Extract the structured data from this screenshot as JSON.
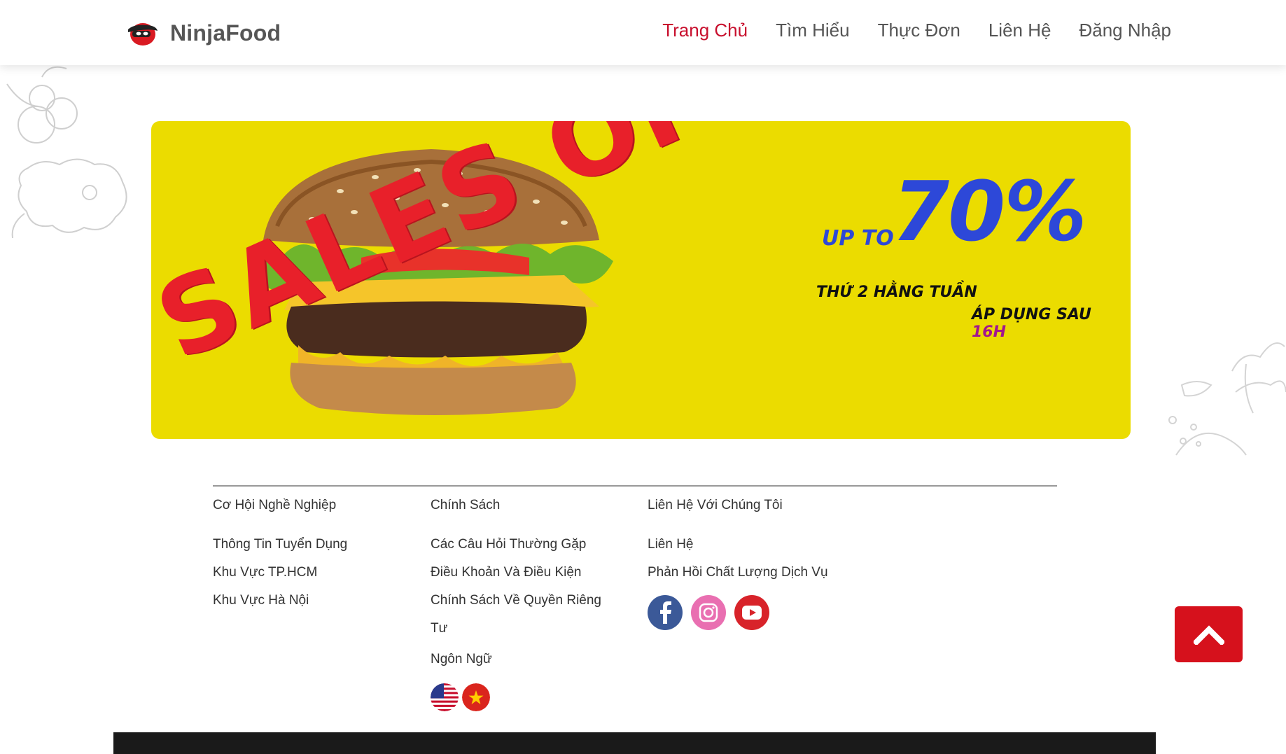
{
  "brand": {
    "name": "NinjaFood"
  },
  "nav": [
    {
      "label": "Trang Chủ",
      "active": true
    },
    {
      "label": "Tìm Hiểu",
      "active": false
    },
    {
      "label": "Thực Đơn",
      "active": false
    },
    {
      "label": "Liên Hệ",
      "active": false
    },
    {
      "label": "Đăng Nhập",
      "active": false
    }
  ],
  "banner": {
    "headline": "SALES OFF",
    "up_to": "UP TO",
    "discount": "70%",
    "line1": "THỨ 2 HẰNG TUẦN",
    "line2_prefix": "ÁP DỤNG SAU",
    "line2_highlight": "16H",
    "background": "#ebdc00"
  },
  "footer": {
    "careers": {
      "heading": "Cơ Hội Nghề Nghiệp",
      "links": [
        "Thông Tin Tuyển Dụng",
        "Khu Vực TP.HCM",
        "Khu Vực Hà Nội"
      ]
    },
    "policy": {
      "heading": "Chính Sách",
      "links": [
        "Các Câu Hỏi Thường Gặp",
        "Điều Khoản Và Điều Kiện",
        "Chính Sách Về Quyền Riêng Tư"
      ],
      "language_heading": "Ngôn Ngữ",
      "languages": [
        "us-flag-icon",
        "vietnam-flag-icon"
      ]
    },
    "contact": {
      "heading": "Liên Hệ Với Chúng Tôi",
      "links": [
        "Liên Hệ",
        "Phản Hồi Chất Lượng Dịch Vụ"
      ],
      "socials": [
        "facebook-icon",
        "instagram-icon",
        "youtube-icon"
      ]
    }
  },
  "colors": {
    "accent": "#c8102e",
    "back_to_top": "#d6111c"
  }
}
